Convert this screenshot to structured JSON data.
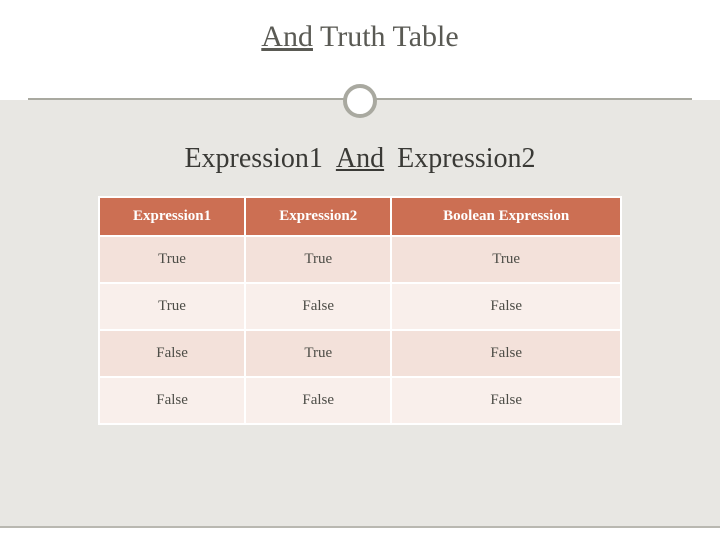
{
  "title": {
    "word1": "And",
    "word2": "Truth Table"
  },
  "subtitle": {
    "left": "Expression1",
    "op": "And",
    "right": "Expression2"
  },
  "table": {
    "headers": [
      "Expression1",
      "Expression2",
      "Boolean Expression"
    ],
    "rows": [
      {
        "c1": "True",
        "c2": "True",
        "c3": "True"
      },
      {
        "c1": "True",
        "c2": "False",
        "c3": "False"
      },
      {
        "c1": "False",
        "c2": "True",
        "c3": "False"
      },
      {
        "c1": "False",
        "c2": "False",
        "c3": "False"
      }
    ]
  },
  "chart_data": {
    "type": "table",
    "title": "And Truth Table",
    "columns": [
      "Expression1",
      "Expression2",
      "Boolean Expression"
    ],
    "rows": [
      [
        "True",
        "True",
        "True"
      ],
      [
        "True",
        "False",
        "False"
      ],
      [
        "False",
        "True",
        "False"
      ],
      [
        "False",
        "False",
        "False"
      ]
    ],
    "operator": "And",
    "expression_template": "Expression1 And Expression2"
  }
}
